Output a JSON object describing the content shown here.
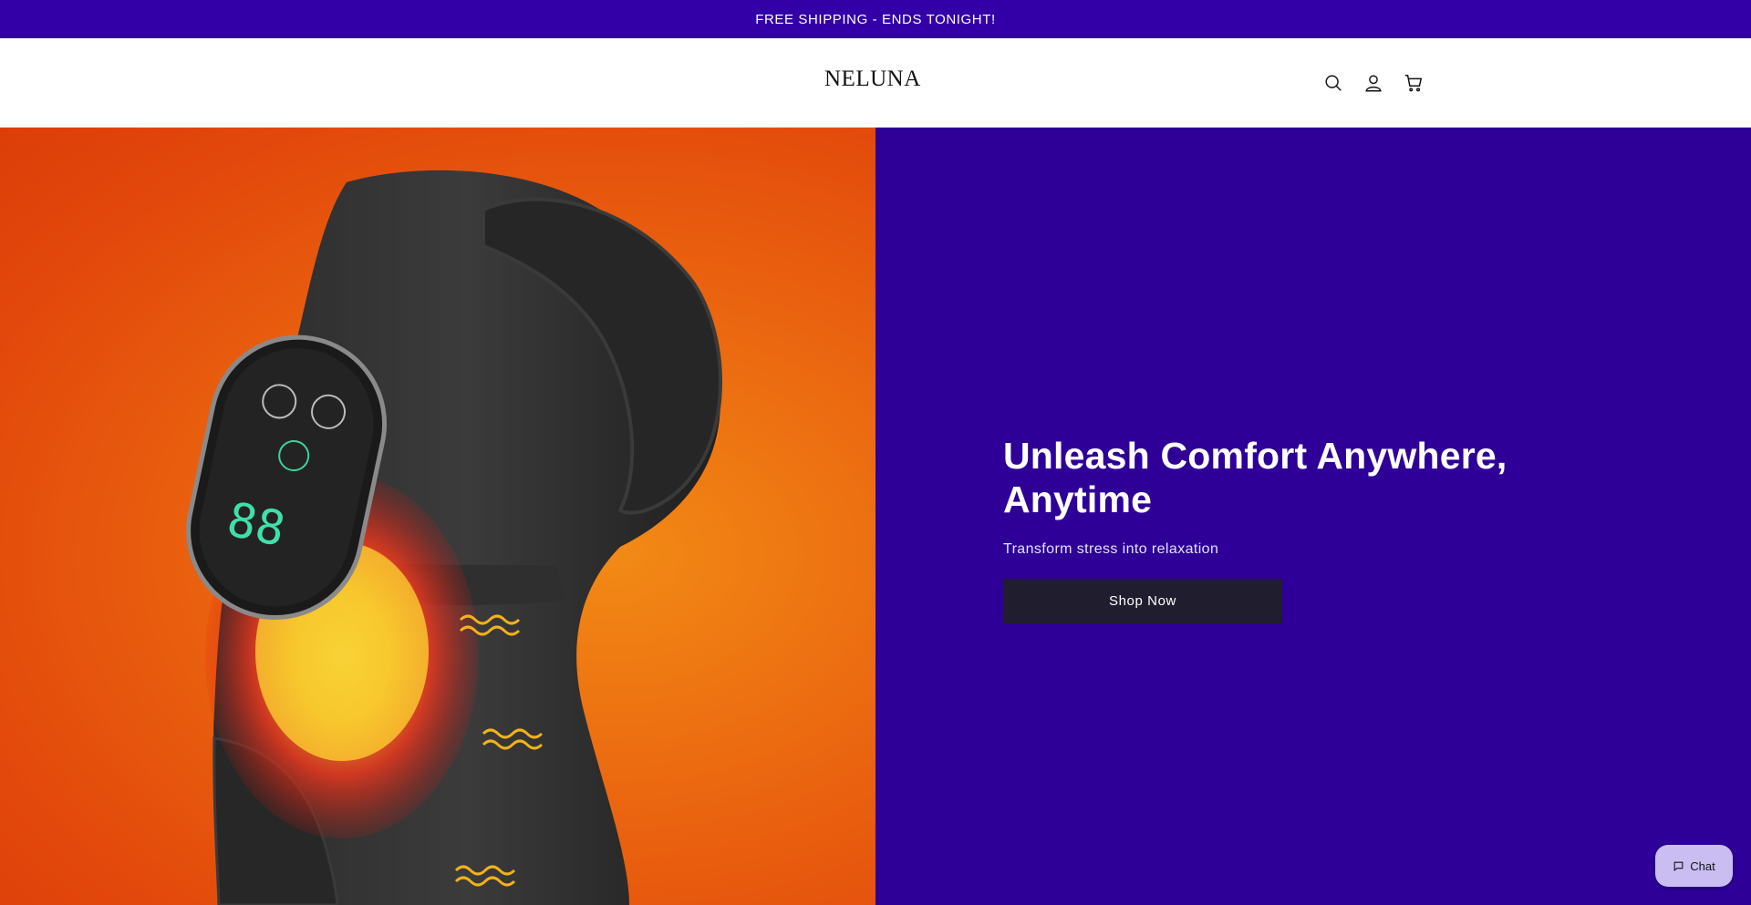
{
  "announcement": {
    "text": "FREE SHIPPING - ENDS TONIGHT!"
  },
  "header": {
    "logo": "NELUNA",
    "icons": [
      "search-icon",
      "account-icon",
      "cart-icon"
    ]
  },
  "hero": {
    "image_alt": "Heated knee massager wrap with digital controller on orange background",
    "title": "Unleash Comfort Anywhere, Anytime",
    "subtitle": "Transform stress into relaxation",
    "cta_label": "Shop Now"
  },
  "chat": {
    "label": "Chat"
  },
  "colors": {
    "brand_purple": "#3200a6",
    "panel_purple": "#2e0098",
    "button_dark": "#201e2e",
    "hero_orange": "#eb6710",
    "chat_bg": "#c9bdf2"
  }
}
